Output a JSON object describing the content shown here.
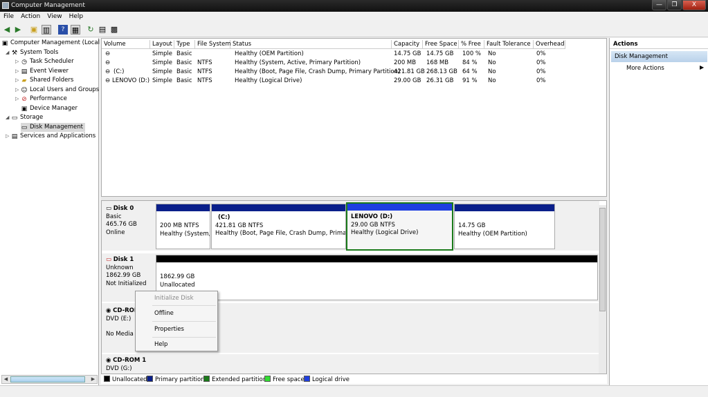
{
  "window": {
    "title": "Computer Management",
    "minimize_glyph": "—",
    "restore_glyph": "❐",
    "close_glyph": "X"
  },
  "menu": [
    "File",
    "Action",
    "View",
    "Help"
  ],
  "tree": {
    "root": "Computer Management (Local",
    "system_tools": "System Tools",
    "task_scheduler": "Task Scheduler",
    "event_viewer": "Event Viewer",
    "shared_folders": "Shared Folders",
    "local_users": "Local Users and Groups",
    "performance": "Performance",
    "device_manager": "Device Manager",
    "storage": "Storage",
    "disk_management": "Disk Management",
    "services": "Services and Applications"
  },
  "volumes": {
    "headers": [
      "Volume",
      "Layout",
      "Type",
      "File System",
      "Status",
      "Capacity",
      "Free Space",
      "% Free",
      "Fault Tolerance",
      "Overhead"
    ],
    "rows": [
      [
        "",
        "Simple",
        "Basic",
        "",
        "Healthy (OEM Partition)",
        "14.75 GB",
        "14.75 GB",
        "100 %",
        "No",
        "0%"
      ],
      [
        "",
        "Simple",
        "Basic",
        "NTFS",
        "Healthy (System, Active, Primary Partition)",
        "200 MB",
        "168 MB",
        "84 %",
        "No",
        "0%"
      ],
      [
        "(C:)",
        "Simple",
        "Basic",
        "NTFS",
        "Healthy (Boot, Page File, Crash Dump, Primary Partition)",
        "421.81 GB",
        "268.13 GB",
        "64 %",
        "No",
        "0%"
      ],
      [
        "LENOVO (D:)",
        "Simple",
        "Basic",
        "NTFS",
        "Healthy (Logical Drive)",
        "29.00 GB",
        "26.31 GB",
        "91 %",
        "No",
        "0%"
      ]
    ]
  },
  "disks": {
    "disk0": {
      "name": "Disk 0",
      "type": "Basic",
      "size": "465.76 GB",
      "state": "Online",
      "partitions": [
        {
          "title": "",
          "size": "200 MB NTFS",
          "status": "Healthy (System,"
        },
        {
          "title": "(C:)",
          "size": "421.81 GB NTFS",
          "status": "Healthy (Boot, Page File, Crash Dump, Primary"
        },
        {
          "title": "LENOVO  (D:)",
          "size": "29.00 GB NTFS",
          "status": "Healthy (Logical Drive)"
        },
        {
          "title": "",
          "size": "14.75 GB",
          "status": "Healthy (OEM Partition)"
        }
      ]
    },
    "disk1": {
      "name": "Disk 1",
      "type": "Unknown",
      "size": "1862.99 GB",
      "state": "Not Initialized",
      "unalloc_size": "1862.99 GB",
      "unalloc_label": "Unallocated"
    },
    "cdrom0": {
      "name": "CD-ROM 0",
      "type": "DVD (E:)",
      "media": "No Media"
    },
    "cdrom1": {
      "name": "CD-ROM 1",
      "type": "DVD (G:)"
    }
  },
  "legend": [
    {
      "label": "Unallocated",
      "color": "#000000"
    },
    {
      "label": "Primary partition",
      "color": "#0a1f8a"
    },
    {
      "label": "Extended partition",
      "color": "#1a7a1a"
    },
    {
      "label": "Free space",
      "color": "#33dd33"
    },
    {
      "label": "Logical drive",
      "color": "#1f3fe0"
    }
  ],
  "actions": {
    "header": "Actions",
    "section": "Disk Management",
    "more": "More Actions"
  },
  "context_menu": {
    "items": [
      "Initialize Disk",
      "Offline",
      "Properties",
      "Help"
    ]
  },
  "colors": {
    "primary_partition": "#0a1f8a",
    "logical_drive": "#1f3fe0",
    "selected_border": "#1a7a1a",
    "unallocated": "#000000"
  }
}
